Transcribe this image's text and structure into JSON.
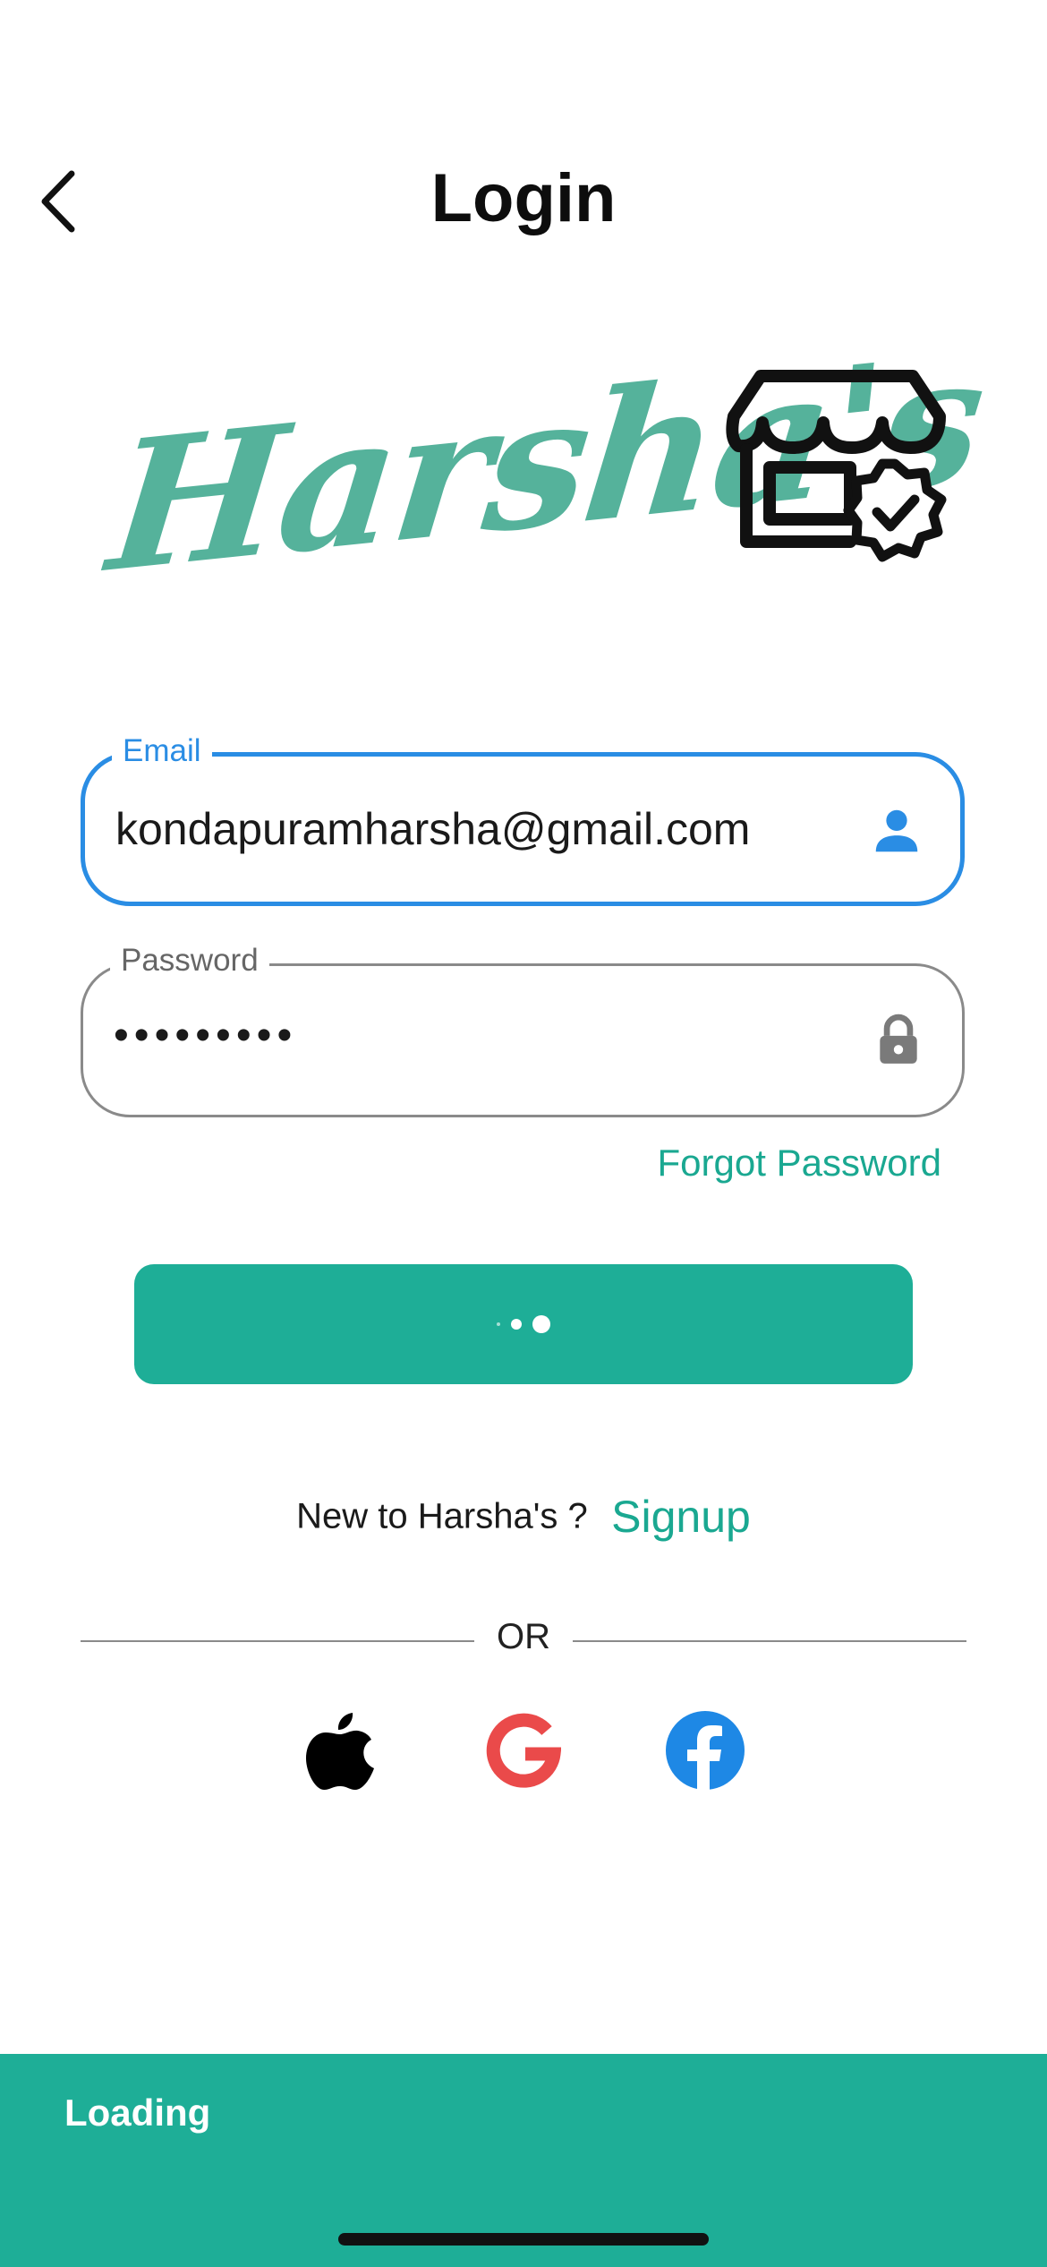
{
  "header": {
    "title": "Login"
  },
  "logo": {
    "text": "Harsha's"
  },
  "form": {
    "email": {
      "label": "Email",
      "value": "kondapuramharsha@gmail.com"
    },
    "password": {
      "label": "Password",
      "value": "•••••••••"
    },
    "forgot_label": "Forgot Password"
  },
  "signup": {
    "question": "New to Harsha's ?",
    "link_label": "Signup"
  },
  "divider": {
    "label": "OR"
  },
  "social": [
    "apple-icon",
    "google-icon",
    "facebook-icon"
  ],
  "snackbar": {
    "message": "Loading"
  },
  "colors": {
    "accent": "#1eae97",
    "focus": "#2a8de4",
    "logo": "#55b29b",
    "google": "#ea4a4a",
    "facebook": "#1e88e5"
  }
}
